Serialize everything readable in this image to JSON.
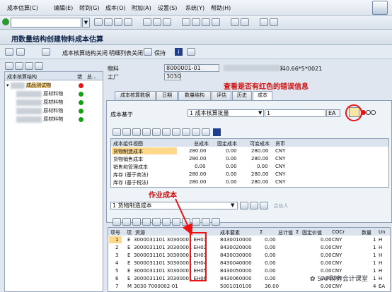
{
  "menu": [
    "成本估算(C)",
    "编辑(E)",
    "转到(G)",
    "成本(O)",
    "附加(A)",
    "设置(S)",
    "系统(Y)",
    "帮助(H)"
  ],
  "title": "用数量结构创建物料成本估算",
  "app_toolbar": {
    "structure_off": "成本核算结构关闭",
    "list_off": "明细列表关闭",
    "save": "保持"
  },
  "header": {
    "material_label": "物料",
    "material_value": "8000001-01",
    "material_desc_suffix": "料0.66*5*0021",
    "plant_label": "工厂",
    "plant_value": "3030"
  },
  "tree": {
    "col1": "成本核算结构",
    "col2": "错",
    "col3": "总...",
    "nodes": [
      {
        "text": "成品测试物",
        "status": "red"
      },
      {
        "text": "原材料物",
        "status": "green"
      },
      {
        "text": "原材料物",
        "status": "green"
      },
      {
        "text": "原材料物",
        "status": "green"
      },
      {
        "text": "原材料物",
        "status": "green"
      }
    ]
  },
  "annotations": {
    "error_hint": "查看是否有红色的错误信息",
    "activity_cost": "作业成本",
    "watermark": "SAP财务会计课堂"
  },
  "tabs": [
    "成本核算数据",
    "日期",
    "数量结构",
    "评估",
    "历史",
    "成本"
  ],
  "cost_base": {
    "label": "成本基于",
    "value": "1 成本核算批量",
    "qty": "1",
    "unit": "EA"
  },
  "upper_grid": {
    "headers": [
      "成本组件视图",
      "总成本",
      "固定成本",
      "可变成本",
      "货币"
    ],
    "rows": [
      [
        "货物制造成本",
        "280.00",
        "0.00",
        "280.00",
        "CNY"
      ],
      [
        "货物销售成本",
        "280.00",
        "0.00",
        "280.00",
        "CNY"
      ],
      [
        "销售和管理成本",
        "0.00",
        "0.00",
        "0.00",
        "CNY"
      ],
      [
        "库存 (基于商法)",
        "280.00",
        "0.00",
        "280.00",
        "CNY"
      ],
      [
        "库存 (基于税法)",
        "280.00",
        "0.00",
        "280.00",
        "CNY"
      ]
    ]
  },
  "lower_select": {
    "value": "1 货物制造成本",
    "partner": "合伙人"
  },
  "lower_grid": {
    "headers": [
      "项号",
      "项",
      "资源",
      "成本要素",
      "Σ",
      "总计值",
      "Σ",
      "固定价值",
      "COCr",
      "数量",
      "Un"
    ],
    "rows": [
      [
        "1",
        "E",
        "3000031101 30300001 EH01",
        "8430010000",
        "0.00",
        "0.00",
        "CNY",
        "1",
        "H"
      ],
      [
        "2",
        "E",
        "3000031101 30300001 EH02",
        "8430020000",
        "0.00",
        "0.00",
        "CNY",
        "1",
        "H"
      ],
      [
        "3",
        "E",
        "3000031101 30300001 EH03",
        "8430030000",
        "0.00",
        "0.00",
        "CNY",
        "1",
        "H"
      ],
      [
        "4",
        "E",
        "3000031101 30300001 EH04",
        "8430040000",
        "0.00",
        "0.00",
        "CNY",
        "1",
        "H"
      ],
      [
        "5",
        "E",
        "3000031101 30300001 EH05",
        "8430050000",
        "0.00",
        "0.00",
        "CNY",
        "1",
        "H"
      ],
      [
        "6",
        "E",
        "3000031101 30300001 EH06",
        "8430060000",
        "0.00",
        "0.00",
        "CNY",
        "1",
        "H"
      ],
      [
        "7",
        "M",
        "3030 7000002-01",
        "5001010100",
        "30.00",
        "0.00",
        "CNY",
        "4",
        "EA"
      ]
    ]
  }
}
